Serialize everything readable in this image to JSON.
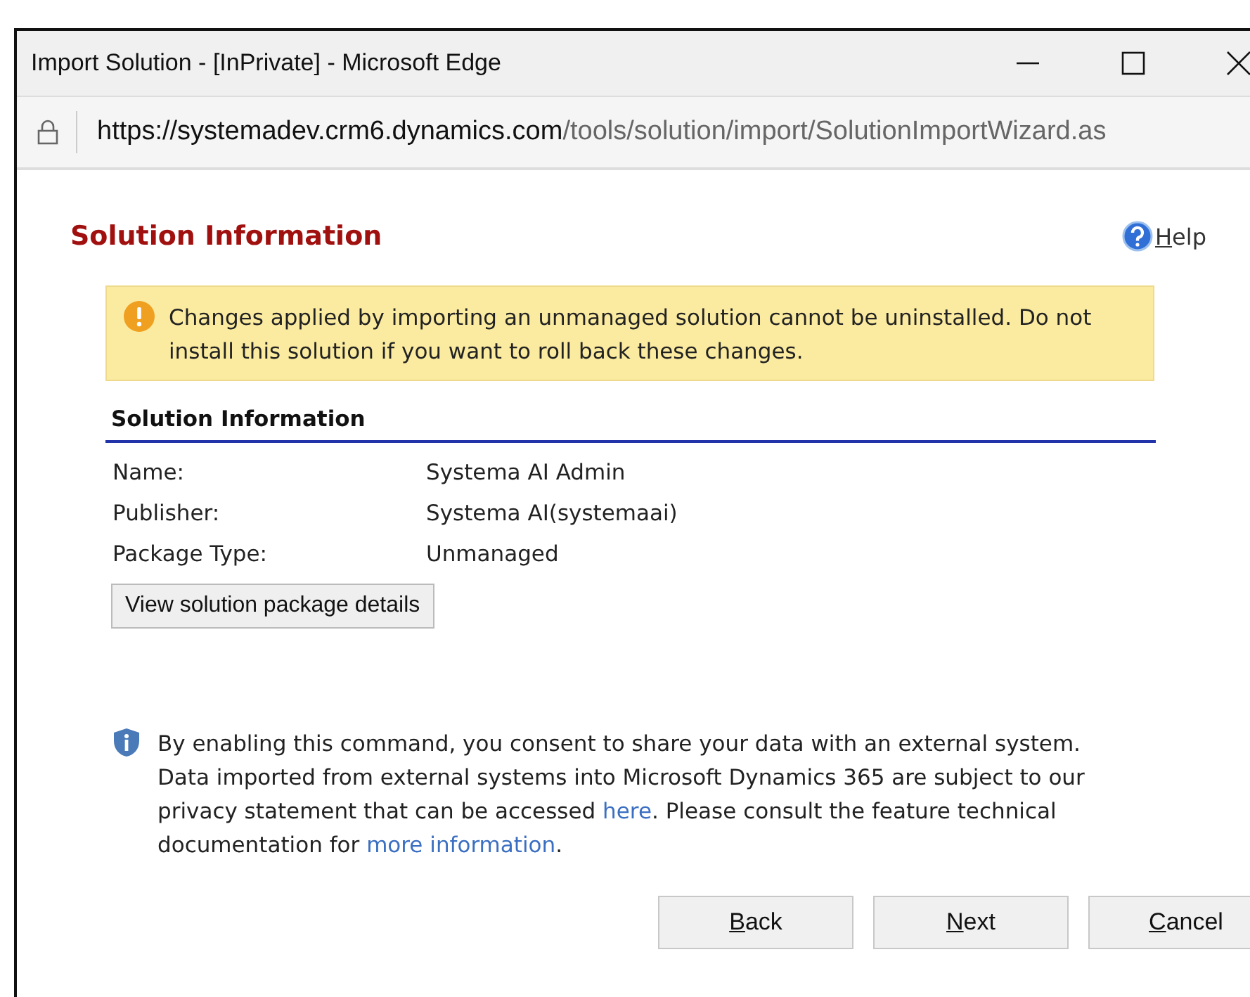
{
  "window": {
    "title": "Import Solution - [InPrivate] - Microsoft Edge"
  },
  "address_bar": {
    "host": "https://systemadev.crm6.dynamics.com",
    "path": "/tools/solution/import/SolutionImportWizard.as"
  },
  "page": {
    "heading": "Solution Information",
    "help": "Help",
    "warning": "Changes applied by importing an unmanaged solution cannot be uninstalled. Do not install this solution if you want to roll back these changes.",
    "section_title": "Solution Information",
    "fields": [
      {
        "label": "Name:",
        "value": "Systema AI Admin"
      },
      {
        "label": "Publisher:",
        "value": "Systema AI(systemaai)"
      },
      {
        "label": "Package Type:",
        "value": "Unmanaged"
      }
    ],
    "details_button": "View solution package details",
    "notice": [
      {
        "text": "By enabling this command, you consent to share your data with an external system. Data imported from external systems into Microsoft Dynamics 365 are subject to our privacy statement that can be accessed ",
        "link": false
      },
      {
        "text": "here",
        "link": true
      },
      {
        "text": ". Please consult the feature technical documentation for ",
        "link": false
      },
      {
        "text": "more information",
        "link": true
      },
      {
        "text": ".",
        "link": false
      }
    ]
  },
  "buttons": [
    "Back",
    "Next",
    "Cancel"
  ]
}
